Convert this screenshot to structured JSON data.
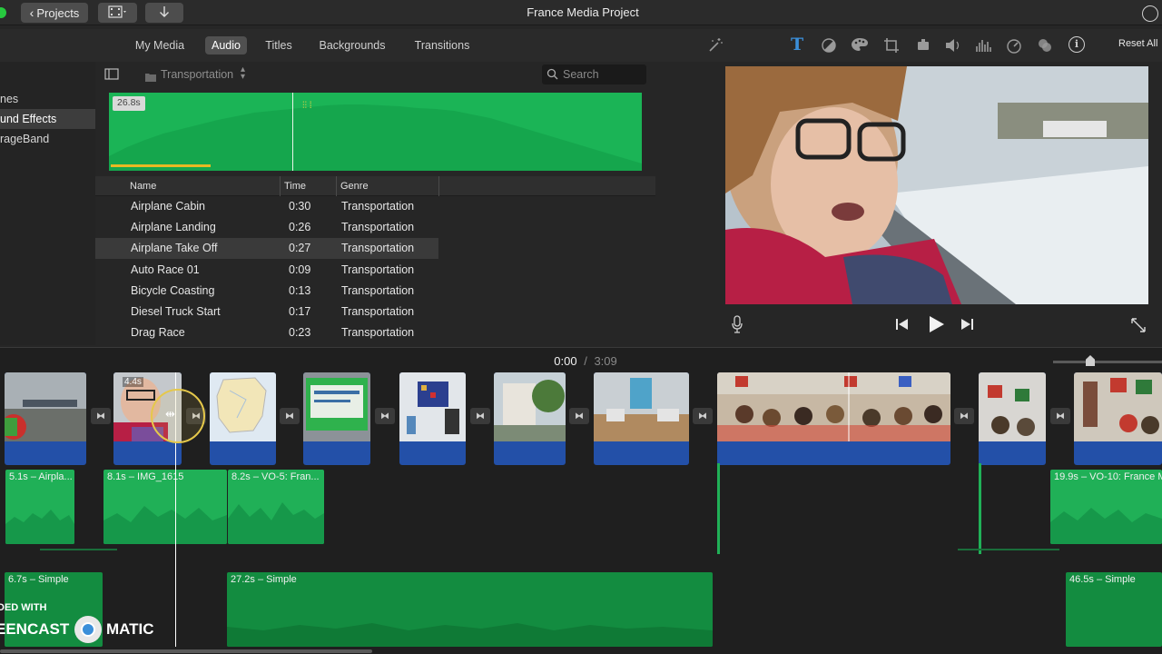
{
  "window": {
    "title": "France Media Project",
    "projects_label": "Projects"
  },
  "media_tabs": [
    {
      "label": "My Media"
    },
    {
      "label": "Audio"
    },
    {
      "label": "Titles"
    },
    {
      "label": "Backgrounds"
    },
    {
      "label": "Transitions"
    }
  ],
  "sidebar": {
    "items": [
      {
        "label": "nes"
      },
      {
        "label": "und Effects"
      },
      {
        "label": "rageBand"
      }
    ]
  },
  "browser": {
    "category_label": "Transportation",
    "search_placeholder": "Search",
    "preview_duration": "26.8s",
    "columns": [
      "Name",
      "Time",
      "Genre"
    ],
    "rows": [
      {
        "name": "Airplane Cabin",
        "time": "0:30",
        "genre": "Transportation"
      },
      {
        "name": "Airplane Landing",
        "time": "0:26",
        "genre": "Transportation"
      },
      {
        "name": "Airplane Take Off",
        "time": "0:27",
        "genre": "Transportation"
      },
      {
        "name": "Auto Race 01",
        "time": "0:09",
        "genre": "Transportation"
      },
      {
        "name": "Bicycle Coasting",
        "time": "0:13",
        "genre": "Transportation"
      },
      {
        "name": "Diesel Truck Start",
        "time": "0:17",
        "genre": "Transportation"
      },
      {
        "name": "Drag Race",
        "time": "0:23",
        "genre": "Transportation"
      }
    ]
  },
  "viewer": {
    "reset_all_label": "Reset All",
    "tool_icons": [
      "magic-wand-icon",
      "title-icon",
      "color-balance-icon",
      "color-correction-icon",
      "crop-icon",
      "stabilization-icon",
      "volume-icon",
      "noise-reduction-icon",
      "speed-icon",
      "filter-icon",
      "info-icon"
    ]
  },
  "timeline": {
    "current_time": "0:00",
    "separator": "/",
    "total_time": "3:09",
    "first_clip_duration": "4.4s",
    "audio_clips": [
      {
        "label": "5.1s – Airpla..."
      },
      {
        "label": "8.1s – IMG_1615"
      },
      {
        "label": "8.2s – VO-5: Fran..."
      },
      {
        "label": "19.9s – VO-10: France M"
      }
    ],
    "music_clips": [
      {
        "label": "6.7s – Simple"
      },
      {
        "label": "27.2s – Simple"
      },
      {
        "label": "46.5s – Simple"
      }
    ],
    "watermark_top": "DED WITH",
    "watermark_left": "EENCAST",
    "watermark_right": "MATIC"
  },
  "colors": {
    "audio_green": "#20b057",
    "video_blue": "#2350a8",
    "accent_blue": "#3b8fd9"
  }
}
